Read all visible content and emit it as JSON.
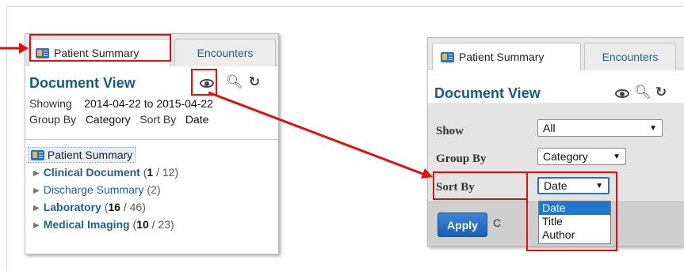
{
  "left_panel": {
    "tabs": [
      {
        "label": "Patient Summary",
        "active": true
      },
      {
        "label": "Encounters",
        "active": false
      }
    ],
    "title": "Document View",
    "toolbar_icons": [
      "eye-icon",
      "search-icon",
      "refresh-icon"
    ],
    "showing_label": "Showing",
    "showing_value": "2014-04-22 to 2015-04-22",
    "group_by_label": "Group By",
    "group_by_value": "Category",
    "sort_by_label": "Sort By",
    "sort_by_value": "Date",
    "tree": {
      "root": "Patient Summary",
      "items": [
        {
          "label": "Clinical Document",
          "bold": true,
          "count_open": "(",
          "count_bold": "1",
          "count_rest": " / 12)"
        },
        {
          "label": "Discharge Summary",
          "bold": false,
          "count_open": "",
          "count_bold": "",
          "count_rest": " (2)"
        },
        {
          "label": "Laboratory",
          "bold": true,
          "count_open": "(",
          "count_bold": "16",
          "count_rest": " / 46)"
        },
        {
          "label": "Medical Imaging",
          "bold": true,
          "count_open": "(",
          "count_bold": "10",
          "count_rest": " / 23)"
        }
      ]
    }
  },
  "right_panel": {
    "tabs": [
      {
        "label": "Patient Summary",
        "active": true
      },
      {
        "label": "Encounters",
        "active": false
      }
    ],
    "title": "Document View",
    "form": {
      "show_label": "Show",
      "show_value": "All",
      "group_by_label": "Group By",
      "group_by_value": "Category",
      "sort_by_label": "Sort By",
      "sort_by_value": "Date",
      "sort_options": [
        "Date",
        "Title",
        "Author"
      ],
      "selected_option": "Date"
    },
    "apply_label": "Apply",
    "footer_hint": "C"
  },
  "colors": {
    "accent_red": "#e01010",
    "title_blue": "#155a8a",
    "apply_blue": "#1a5fb2",
    "selection_blue": "#1e78d2"
  }
}
